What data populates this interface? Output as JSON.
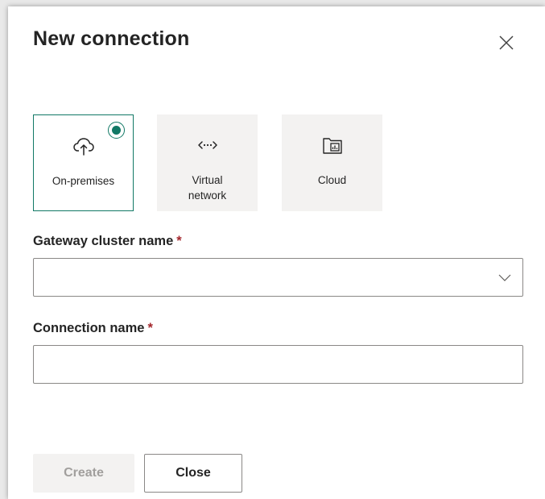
{
  "dialog": {
    "title": "New connection"
  },
  "connection_types": [
    {
      "label_line1": "On-premises",
      "label_line2": "",
      "icon": "cloud-upload-icon",
      "selected": true
    },
    {
      "label_line1": "Virtual",
      "label_line2": "network",
      "icon": "virtual-network-icon",
      "selected": false
    },
    {
      "label_line1": "Cloud",
      "label_line2": "",
      "icon": "cloud-folder-icon",
      "selected": false
    }
  ],
  "gateway": {
    "label": "Gateway cluster name",
    "required_mark": "*",
    "value": ""
  },
  "connection_name": {
    "label": "Connection name",
    "required_mark": "*",
    "value": ""
  },
  "buttons": {
    "create": "Create",
    "close": "Close"
  },
  "colors": {
    "accent": "#117865",
    "required": "#a4262c",
    "disabled_text": "#a19f9d",
    "tile_bg": "#f3f2f1"
  }
}
